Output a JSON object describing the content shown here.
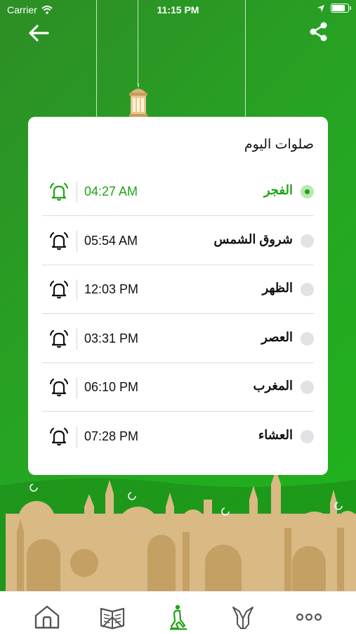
{
  "status": {
    "carrier": "Carrier",
    "time": "11:15 PM"
  },
  "card": {
    "title": "صلوات اليوم",
    "prayers": [
      {
        "name": "الفجر",
        "time": "04:27 AM",
        "active": true
      },
      {
        "name": "شروق الشمس",
        "time": "05:54 AM",
        "active": false
      },
      {
        "name": "الظهر",
        "time": "12:03 PM",
        "active": false
      },
      {
        "name": "العصر",
        "time": "03:31 PM",
        "active": false
      },
      {
        "name": "المغرب",
        "time": "06:10 PM",
        "active": false
      },
      {
        "name": "العشاء",
        "time": "07:28 PM",
        "active": false
      }
    ]
  },
  "icons": {
    "back": "arrow-left-icon",
    "share": "share-icon",
    "bell": "alarm-bell-icon",
    "tabs": [
      "home-icon",
      "quran-book-icon",
      "prayer-person-icon",
      "dua-hands-icon",
      "more-dots-icon"
    ]
  },
  "colors": {
    "primary": "#1ea414",
    "hero_green": "#27a324",
    "sand": "#dcbf8e"
  }
}
